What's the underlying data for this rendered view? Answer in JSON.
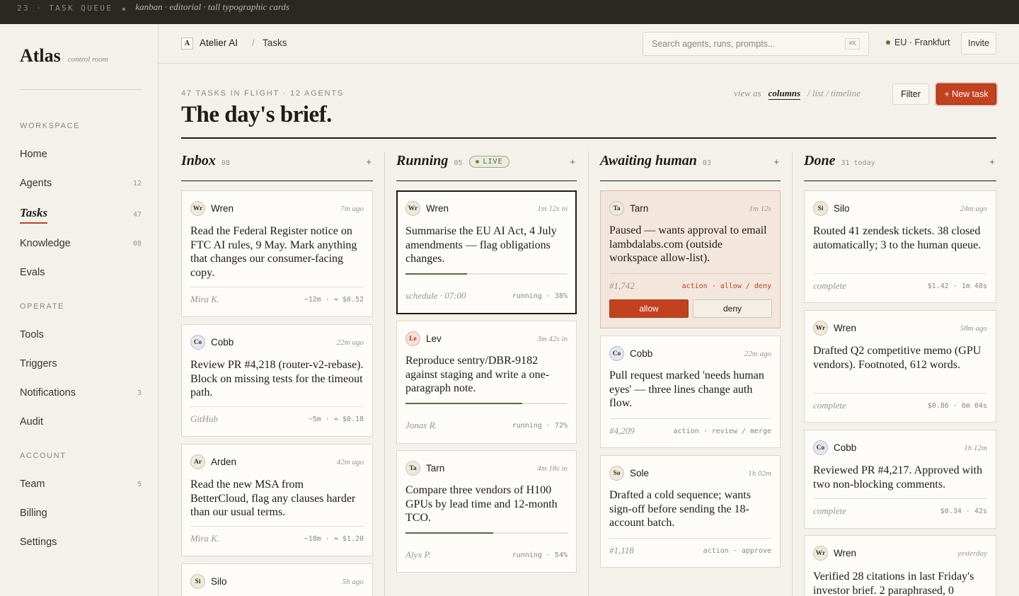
{
  "strip": {
    "label": "23 · TASK QUEUE",
    "sub": "kanban · editorial · tall typographic cards"
  },
  "brand": {
    "name": "Atlas",
    "tag": "control room"
  },
  "sidebar": {
    "sections": [
      {
        "label": "WORKSPACE",
        "items": [
          {
            "label": "Home",
            "count": ""
          },
          {
            "label": "Agents",
            "count": "12"
          },
          {
            "label": "Tasks",
            "count": "47",
            "active": true
          },
          {
            "label": "Knowledge",
            "count": "08"
          },
          {
            "label": "Evals",
            "count": ""
          }
        ]
      },
      {
        "label": "OPERATE",
        "items": [
          {
            "label": "Tools",
            "count": ""
          },
          {
            "label": "Triggers",
            "count": ""
          },
          {
            "label": "Notifications",
            "count": "3"
          },
          {
            "label": "Audit",
            "count": ""
          }
        ]
      },
      {
        "label": "ACCOUNT",
        "items": [
          {
            "label": "Team",
            "count": "5"
          },
          {
            "label": "Billing",
            "count": ""
          },
          {
            "label": "Settings",
            "count": ""
          }
        ]
      }
    ]
  },
  "header": {
    "ws_badge": "A",
    "workspace": "Atelier AI",
    "sep": "/",
    "crumb": "Tasks",
    "search_placeholder": "Search agents, runs, prompts...",
    "search_kbd": "⌘K",
    "region": "EU · Frankfurt",
    "invite": "Invite"
  },
  "page": {
    "eyebrow": "47 TASKS IN FLIGHT · 12 AGENTS",
    "title": "The day's brief.",
    "view_as": "view as",
    "view_active": "columns",
    "view_other": "/ list / timeline",
    "filter": "Filter",
    "new_task": "+ New task"
  },
  "columns": [
    {
      "title": "Inbox",
      "count": "08",
      "plus": "+",
      "cards": [
        {
          "av": "Wr",
          "agent": "Wren",
          "ago": "7m ago",
          "body": "Read the Federal Register notice on FTC AI rules, 9 May. Mark anything that changes our consumer-facing copy.",
          "foot_l": "Mira K.",
          "foot_r": "~12m · ≈ $0.52"
        },
        {
          "av": "Co",
          "agent": "Cobb",
          "ago": "22m ago",
          "body": "Review PR #4,218 (router-v2-rebase). Block on missing tests for the timeout path.",
          "foot_l": "GitHub",
          "foot_r": "~5m · ≈ $0.18"
        },
        {
          "av": "Ar",
          "agent": "Arden",
          "ago": "42m ago",
          "body": "Read the new MSA from BetterCloud, flag any clauses harder than our usual terms.",
          "foot_l": "Mira K.",
          "foot_r": "~18m · ≈ $1.20"
        },
        {
          "av": "Si",
          "agent": "Silo",
          "ago": "5h ago"
        }
      ]
    },
    {
      "title": "Running",
      "count": "05",
      "live": "LIVE",
      "plus": "+",
      "cards": [
        {
          "av": "Wr",
          "agent": "Wren",
          "ago": "1m 12s in",
          "body": "Summarise the EU AI Act, 4 July amendments — flag obligations changes.",
          "progress": 0.38,
          "foot_l": "schedule · 07:00",
          "foot_r": "running · 38%"
        },
        {
          "av": "Le",
          "agent": "Lev",
          "ago": "3m 42s in",
          "body": "Reproduce sentry/DBR-9182 against staging and write a one-paragraph note.",
          "progress": 0.72,
          "foot_l": "Jonas R.",
          "foot_r": "running · 72%"
        },
        {
          "av": "Ta",
          "agent": "Tarn",
          "ago": "4m 18s in",
          "body": "Compare three vendors of H100 GPUs by lead time and 12-month TCO.",
          "progress": 0.54,
          "foot_l": "Alyx P.",
          "foot_r": "running · 54%"
        }
      ]
    },
    {
      "title": "Awaiting human",
      "count": "03",
      "plus": "+",
      "cards": [
        {
          "av": "Ta",
          "agent": "Tarn",
          "ago": "1m 12s",
          "body": "Paused — wants approval to email lambdalabs.com (outside workspace allow-list).",
          "foot_l": "#1,742",
          "foot_r": "action · allow / deny",
          "allow": "allow",
          "deny": "deny"
        },
        {
          "av": "Co",
          "agent": "Cobb",
          "ago": "22m ago",
          "body": "Pull request marked 'needs human eyes' — three lines change auth flow.",
          "foot_l": "#4,209",
          "foot_r": "action · review / merge"
        },
        {
          "av": "So",
          "agent": "Sole",
          "ago": "1h 02m",
          "body": "Drafted a cold sequence; wants sign-off before sending the 18-account batch.",
          "foot_l": "#1,118",
          "foot_r": "action · approve"
        }
      ]
    },
    {
      "title": "Done",
      "count": "31 today",
      "plus": "+",
      "cards": [
        {
          "av": "Si",
          "agent": "Silo",
          "ago": "24m ago",
          "body": "Routed 41 zendesk tickets. 38 closed automatically; 3 to the human queue.",
          "foot_l": "complete",
          "foot_r": "$1.42 · 1m 48s"
        },
        {
          "av": "Wr",
          "agent": "Wren",
          "ago": "58m ago",
          "body": "Drafted Q2 competitive memo (GPU vendors). Footnoted, 612 words.",
          "foot_l": "complete",
          "foot_r": "$0.86 · 6m 04s"
        },
        {
          "av": "Co",
          "agent": "Cobb",
          "ago": "1h 12m",
          "body": "Reviewed PR #4,217. Approved with two non-blocking comments.",
          "foot_l": "complete",
          "foot_r": "$0.34 · 42s"
        },
        {
          "av": "Wr",
          "agent": "Wren",
          "ago": "yesterday",
          "body": "Verified 28 citations in last Friday's investor brief. 2 paraphrased, 0"
        }
      ]
    }
  ]
}
